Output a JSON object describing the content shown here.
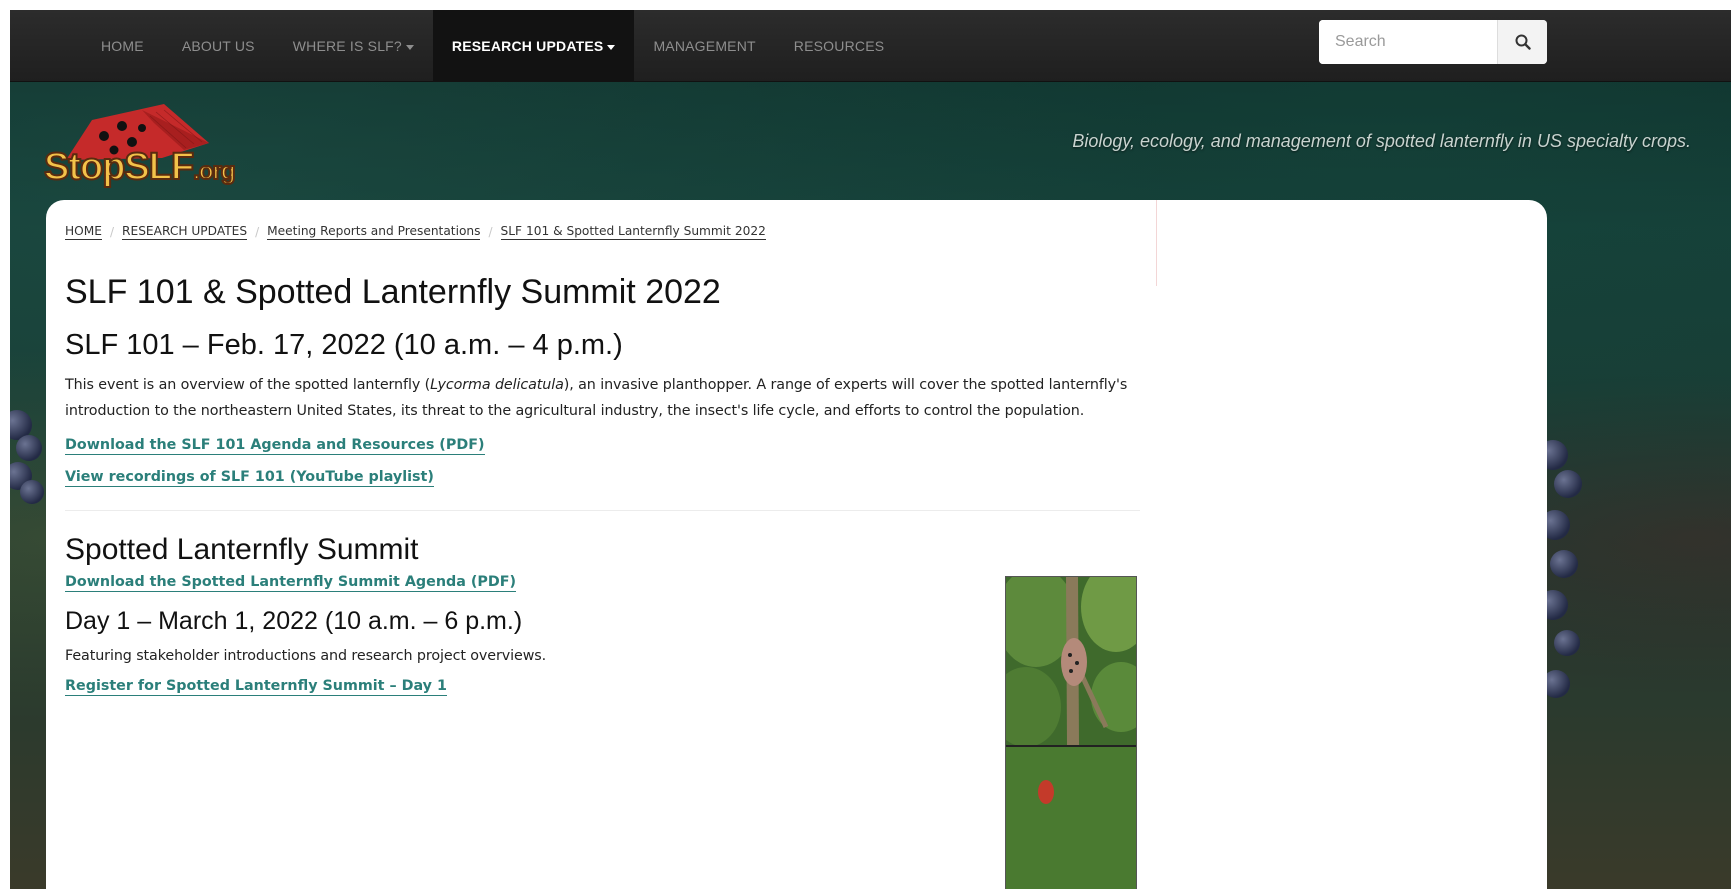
{
  "nav": {
    "items": [
      {
        "label": "HOME",
        "dropdown": false,
        "active": false
      },
      {
        "label": "ABOUT US",
        "dropdown": false,
        "active": false
      },
      {
        "label": "WHERE IS SLF?",
        "dropdown": true,
        "active": false
      },
      {
        "label": "RESEARCH UPDATES",
        "dropdown": true,
        "active": true
      },
      {
        "label": "MANAGEMENT",
        "dropdown": false,
        "active": false
      },
      {
        "label": "RESOURCES",
        "dropdown": false,
        "active": false
      }
    ],
    "search_placeholder": "Search",
    "search_icon": "search-icon"
  },
  "header": {
    "logo_text": "StopSLF",
    "logo_suffix": ".org",
    "tagline": "Biology, ecology, and management of spotted lanternfly in US specialty crops."
  },
  "breadcrumb": [
    "HOME",
    "RESEARCH UPDATES",
    "Meeting Reports and Presentations",
    "SLF 101 & Spotted Lanternfly Summit 2022"
  ],
  "page": {
    "title": "SLF 101 & Spotted Lanternfly Summit 2022",
    "slf101": {
      "heading": "SLF 101 – Feb. 17, 2022 (10 a.m. – 4 p.m.)",
      "desc_before": "This event is an overview of the spotted lanternfly (",
      "desc_italic": "Lycorma delicatula",
      "desc_after": "), an invasive planthopper. A range of experts will cover the spotted lanternfly's introduction to the northeastern United States, its threat to the agricultural industry, the insect's life cycle, and efforts to control the population.",
      "link_agenda": "Download the SLF 101 Agenda and Resources (PDF)",
      "link_recordings": "View recordings of SLF 101 (YouTube playlist)"
    },
    "summit": {
      "heading": "Spotted Lanternfly Summit",
      "link_agenda": "Download the Spotted Lanternfly Summit Agenda (PDF)",
      "day1_heading": "Day 1 – March 1, 2022 (10 a.m. – 6 p.m.)",
      "day1_desc": "Featuring stakeholder introductions and research project overviews.",
      "day1_link": "Register for Spotted Lanternfly Summit – Day 1"
    }
  },
  "colors": {
    "nav_bg": "#242424",
    "link": "#2b7f7a",
    "logo_red": "#c52a2a",
    "tagline": "#c8d3cf"
  }
}
